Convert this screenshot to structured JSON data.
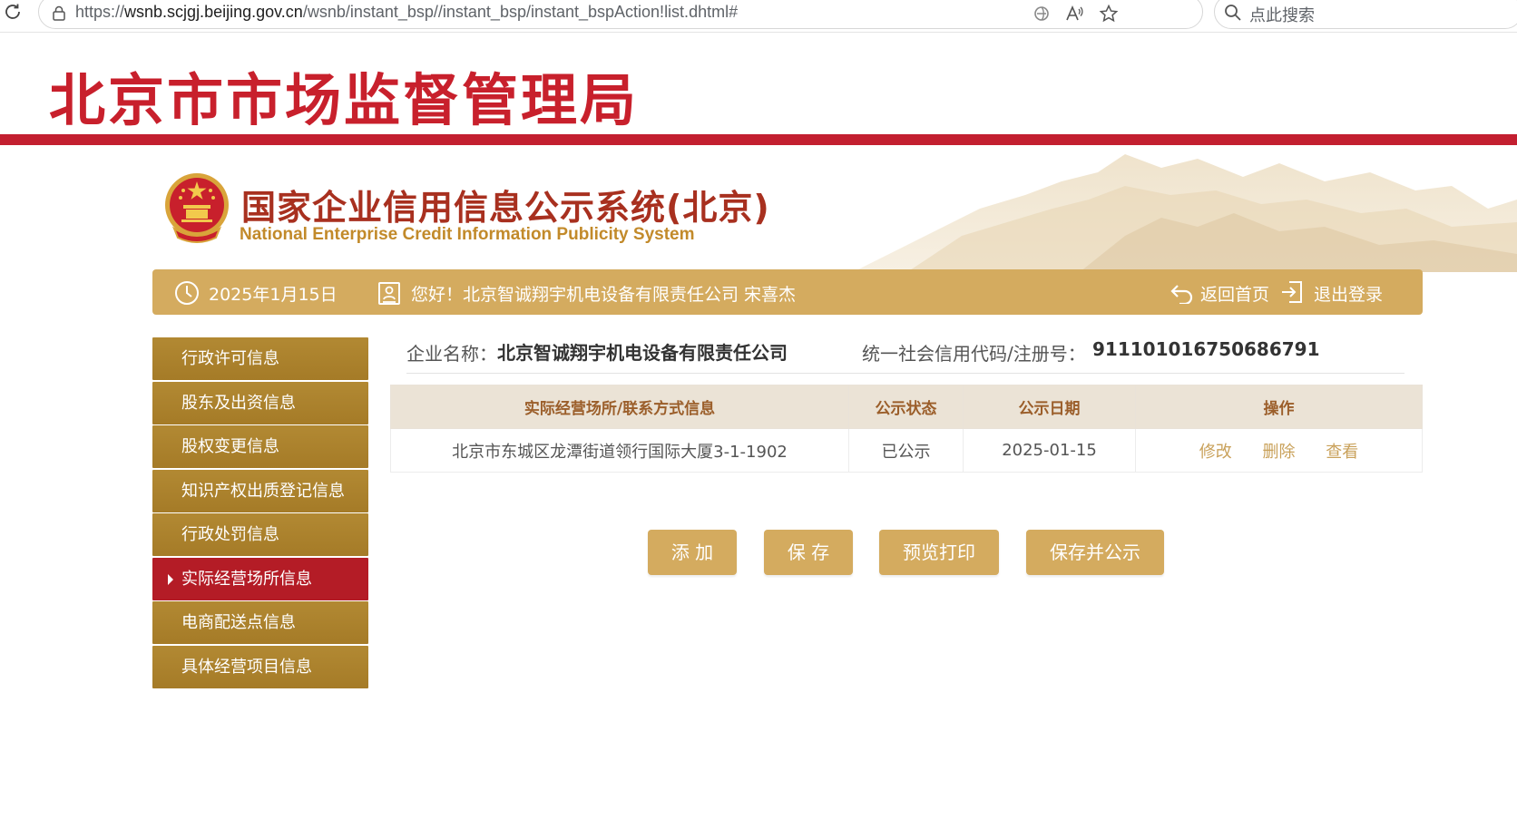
{
  "browser": {
    "url_prefix": "https://",
    "url_host": "wsnb.scjgj.beijing.gov.cn",
    "url_path": "/wsnb/instant_bsp//instant_bsp/instant_bspAction!list.dhtml#",
    "search_placeholder": "点此搜索"
  },
  "header": {
    "bureau_title": "北京市市场监督管理局",
    "system_title_cn": "国家企业信用信息公示系统(北京)",
    "system_title_en": "National Enterprise Credit Information Publicity System"
  },
  "infobar": {
    "date": "2025年1月15日",
    "greeting": "您好！北京智诚翔宇机电设备有限责任公司  宋喜杰",
    "home_label": "返回首页",
    "logout_label": "退出登录"
  },
  "sidebar": {
    "items": [
      {
        "label": "行政许可信息"
      },
      {
        "label": "股东及出资信息"
      },
      {
        "label": "股权变更信息"
      },
      {
        "label": "知识产权出质登记信息"
      },
      {
        "label": "行政处罚信息"
      },
      {
        "label": "实际经营场所信息"
      },
      {
        "label": "电商配送点信息"
      },
      {
        "label": "具体经营项目信息"
      }
    ],
    "active_index": 5
  },
  "company": {
    "name_label": "企业名称：",
    "name": "北京智诚翔宇机电设备有限责任公司",
    "code_label": "统一社会信用代码/注册号：",
    "code": "911101016750686791"
  },
  "table": {
    "headers": [
      "实际经营场所/联系方式信息",
      "公示状态",
      "公示日期",
      "操作"
    ],
    "rows": [
      {
        "address": "北京市东城区龙潭街道领行国际大厦3-1-1902",
        "status": "已公示",
        "date": "2025-01-15",
        "edit": "修改",
        "delete": "删除",
        "view": "查看"
      }
    ]
  },
  "buttons": {
    "add": "添 加",
    "save": "保 存",
    "preview_print": "预览打印",
    "save_publish": "保存并公示"
  },
  "colors": {
    "brand_red": "#c31f30",
    "gold": "#d4ab5f",
    "sidebar_gold": "#a97f2b",
    "active_red": "#b41c26"
  }
}
